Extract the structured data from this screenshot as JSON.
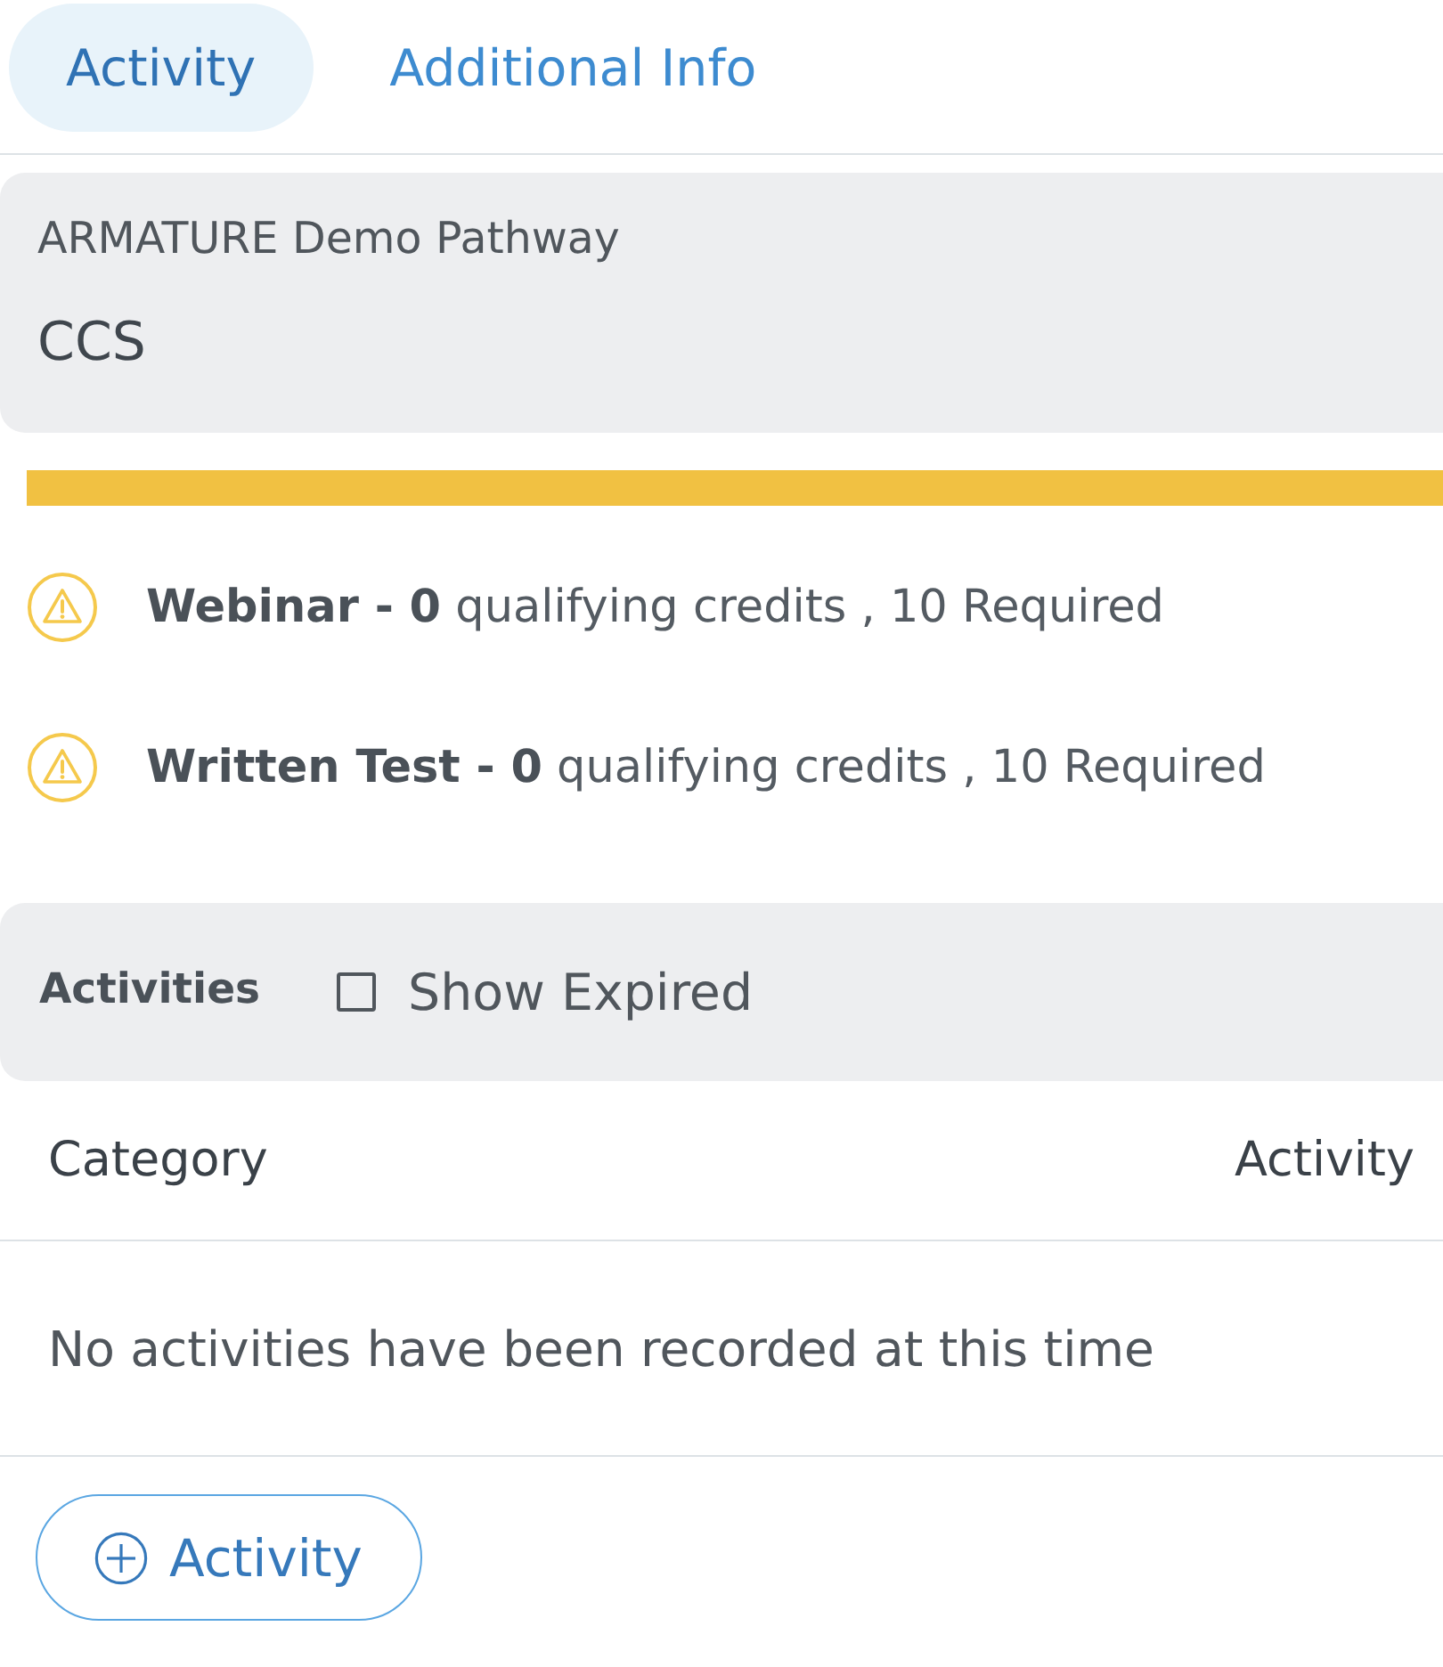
{
  "tabs": [
    {
      "label": "Activity",
      "selected": true
    },
    {
      "label": "Additional Info",
      "selected": false
    }
  ],
  "pathway": {
    "name": "ARMATURE Demo Pathway",
    "code": "CCS"
  },
  "requirements": [
    {
      "text": "**Webinar - 0** qualifying credits , 10 Required"
    },
    {
      "text": "**Written Test - 0** qualifying credits , 10 Required"
    }
  ],
  "activities": {
    "title": "Activities",
    "show_expired": {
      "label": "Show Expired",
      "checked": false
    }
  },
  "table": {
    "columns": [
      "Category",
      "Activity"
    ],
    "empty_message": "No activities have been recorded at this time"
  },
  "add_button": {
    "label": "Activity"
  }
}
